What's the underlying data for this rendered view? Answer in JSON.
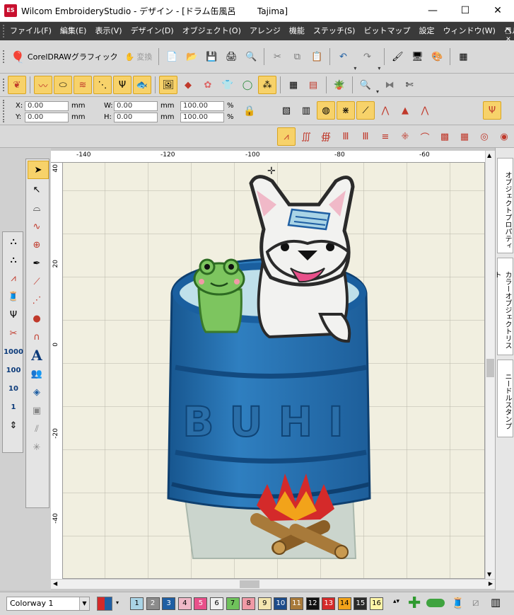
{
  "titlebar": {
    "app_icon": "ES",
    "title": "Wilcom EmbroideryStudio - デザイン - [ドラム缶風呂        Tajima]",
    "minimize": "—",
    "maximize": "☐",
    "close": "✕"
  },
  "menu": [
    "ファイル(F)",
    "編集(E)",
    "表示(V)",
    "デザイン(D)",
    "オブジェクト(O)",
    "アレンジ",
    "機能",
    "ステッチ(S)",
    "ビットマップ",
    "設定",
    "ウィンドウ(W)",
    "ヘルプ(H)"
  ],
  "toolbar1": {
    "coreldraw": "CorelDRAWグラフィック",
    "convert": "変換"
  },
  "coords": {
    "x_label": "X:",
    "y_label": "Y:",
    "w_label": "W:",
    "h_label": "H:",
    "x": "0.00",
    "y": "0.00",
    "w": "0.00",
    "h": "0.00",
    "unit": "mm",
    "pw": "100.00",
    "ph": "100.00",
    "pct": "%"
  },
  "ruler": {
    "h_ticks": [
      "-140",
      "-120",
      "-100",
      "-80",
      "-60"
    ],
    "v_ticks": [
      "40",
      "20",
      "0",
      "-20",
      "-40"
    ]
  },
  "design": {
    "barrel_text": "BUHI"
  },
  "dock_tabs": [
    "オブジェクトプロパティ",
    "カラーオブジェクトリスト",
    "ニードルスタンプ"
  ],
  "status": {
    "colorway": "Colorway 1"
  },
  "colors": [
    {
      "n": "1",
      "c": "#a9d4e6",
      "t": "#000"
    },
    {
      "n": "2",
      "c": "#8c8c8c",
      "t": "#fff"
    },
    {
      "n": "3",
      "c": "#1f5fa3",
      "t": "#fff"
    },
    {
      "n": "4",
      "c": "#f0b9c8",
      "t": "#000"
    },
    {
      "n": "5",
      "c": "#e8508a",
      "t": "#fff"
    },
    {
      "n": "6",
      "c": "#f2f2f2",
      "t": "#000"
    },
    {
      "n": "7",
      "c": "#6fc25b",
      "t": "#000"
    },
    {
      "n": "8",
      "c": "#f09aa6",
      "t": "#000"
    },
    {
      "n": "9",
      "c": "#f4e6b0",
      "t": "#000"
    },
    {
      "n": "10",
      "c": "#1c4b8a",
      "t": "#fff"
    },
    {
      "n": "11",
      "c": "#a87a3a",
      "t": "#fff"
    },
    {
      "n": "12",
      "c": "#111111",
      "t": "#fff"
    },
    {
      "n": "13",
      "c": "#d42a2a",
      "t": "#fff"
    },
    {
      "n": "14",
      "c": "#f2a31a",
      "t": "#000"
    },
    {
      "n": "15",
      "c": "#2a2a2a",
      "t": "#fff"
    },
    {
      "n": "16",
      "c": "#fff6a8",
      "t": "#000"
    }
  ]
}
